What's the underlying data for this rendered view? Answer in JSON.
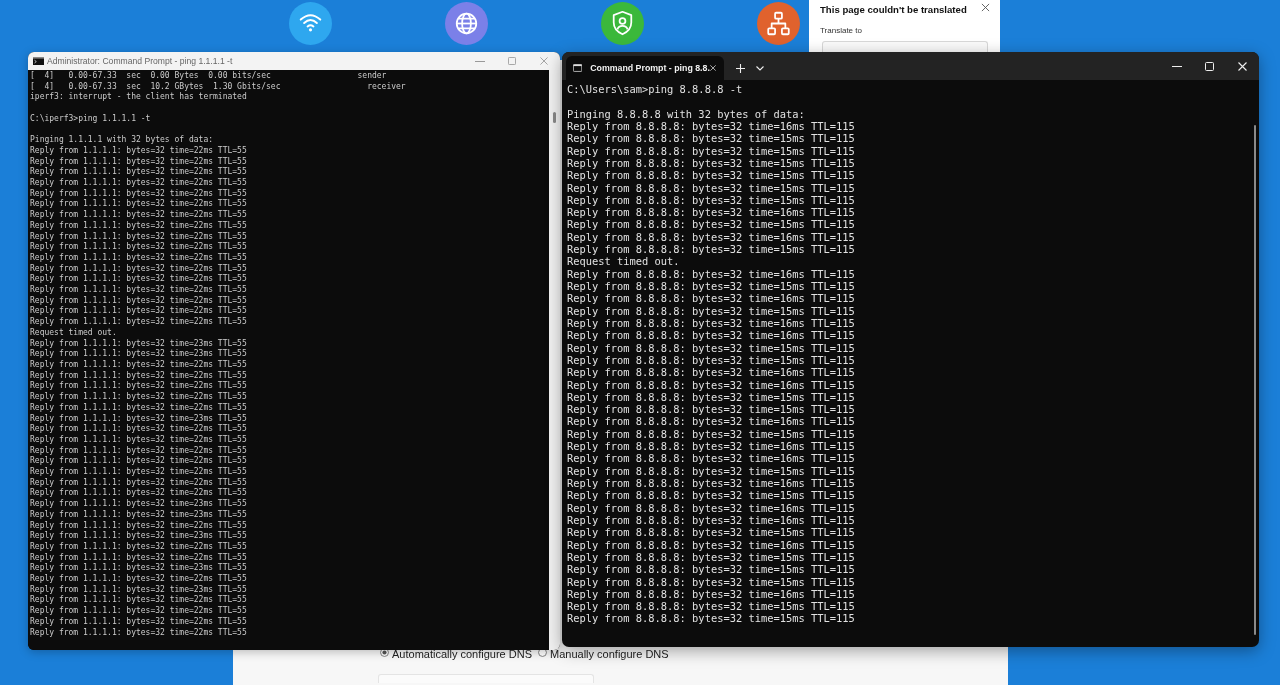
{
  "translate_popup": {
    "title": "This page couldn't be translated",
    "label": "Translate to"
  },
  "left_window": {
    "title": "Administrator: Command Prompt - ping 1.1.1.1 -t",
    "blocks": [
      [
        "[  4]   0.00-67.33  sec  0.00 Bytes  0.00 bits/sec                  sender",
        "[  4]   0.00-67.33  sec  10.2 GBytes  1.30 Gbits/sec                  receiver",
        "iperf3: interrupt - the client has terminated"
      ],
      [
        "C:\\iperf3>ping 1.1.1.1 -t"
      ],
      [
        "Pinging 1.1.1.1 with 32 bytes of data:",
        "Reply from 1.1.1.1: bytes=32 time=22ms TTL=55",
        "Reply from 1.1.1.1: bytes=32 time=22ms TTL=55",
        "Reply from 1.1.1.1: bytes=32 time=22ms TTL=55",
        "Reply from 1.1.1.1: bytes=32 time=22ms TTL=55",
        "Reply from 1.1.1.1: bytes=32 time=22ms TTL=55",
        "Reply from 1.1.1.1: bytes=32 time=22ms TTL=55",
        "Reply from 1.1.1.1: bytes=32 time=22ms TTL=55",
        "Reply from 1.1.1.1: bytes=32 time=22ms TTL=55",
        "Reply from 1.1.1.1: bytes=32 time=22ms TTL=55",
        "Reply from 1.1.1.1: bytes=32 time=22ms TTL=55",
        "Reply from 1.1.1.1: bytes=32 time=22ms TTL=55",
        "Reply from 1.1.1.1: bytes=32 time=22ms TTL=55",
        "Reply from 1.1.1.1: bytes=32 time=22ms TTL=55",
        "Reply from 1.1.1.1: bytes=32 time=22ms TTL=55",
        "Reply from 1.1.1.1: bytes=32 time=22ms TTL=55",
        "Reply from 1.1.1.1: bytes=32 time=22ms TTL=55",
        "Reply from 1.1.1.1: bytes=32 time=22ms TTL=55",
        "Request timed out.",
        "Reply from 1.1.1.1: bytes=32 time=23ms TTL=55",
        "Reply from 1.1.1.1: bytes=32 time=23ms TTL=55",
        "Reply from 1.1.1.1: bytes=32 time=22ms TTL=55",
        "Reply from 1.1.1.1: bytes=32 time=22ms TTL=55",
        "Reply from 1.1.1.1: bytes=32 time=22ms TTL=55",
        "Reply from 1.1.1.1: bytes=32 time=22ms TTL=55",
        "Reply from 1.1.1.1: bytes=32 time=22ms TTL=55",
        "Reply from 1.1.1.1: bytes=32 time=23ms TTL=55",
        "Reply from 1.1.1.1: bytes=32 time=22ms TTL=55",
        "Reply from 1.1.1.1: bytes=32 time=22ms TTL=55",
        "Reply from 1.1.1.1: bytes=32 time=22ms TTL=55",
        "Reply from 1.1.1.1: bytes=32 time=22ms TTL=55",
        "Reply from 1.1.1.1: bytes=32 time=22ms TTL=55",
        "Reply from 1.1.1.1: bytes=32 time=22ms TTL=55",
        "Reply from 1.1.1.1: bytes=32 time=22ms TTL=55",
        "Reply from 1.1.1.1: bytes=32 time=23ms TTL=55",
        "Reply from 1.1.1.1: bytes=32 time=23ms TTL=55",
        "Reply from 1.1.1.1: bytes=32 time=22ms TTL=55",
        "Reply from 1.1.1.1: bytes=32 time=23ms TTL=55",
        "Reply from 1.1.1.1: bytes=32 time=22ms TTL=55",
        "Reply from 1.1.1.1: bytes=32 time=22ms TTL=55",
        "Reply from 1.1.1.1: bytes=32 time=23ms TTL=55",
        "Reply from 1.1.1.1: bytes=32 time=22ms TTL=55",
        "Reply from 1.1.1.1: bytes=32 time=23ms TTL=55",
        "Reply from 1.1.1.1: bytes=32 time=22ms TTL=55",
        "Reply from 1.1.1.1: bytes=32 time=22ms TTL=55",
        "Reply from 1.1.1.1: bytes=32 time=22ms TTL=55",
        "Reply from 1.1.1.1: bytes=32 time=22ms TTL=55"
      ]
    ]
  },
  "right_window": {
    "tab_title": "Command Prompt - ping 8.8.",
    "blocks": [
      [
        "C:\\Users\\sam>ping 8.8.8.8 -t"
      ],
      [
        "Pinging 8.8.8.8 with 32 bytes of data:",
        "Reply from 8.8.8.8: bytes=32 time=16ms TTL=115",
        "Reply from 8.8.8.8: bytes=32 time=15ms TTL=115",
        "Reply from 8.8.8.8: bytes=32 time=15ms TTL=115",
        "Reply from 8.8.8.8: bytes=32 time=15ms TTL=115",
        "Reply from 8.8.8.8: bytes=32 time=15ms TTL=115",
        "Reply from 8.8.8.8: bytes=32 time=15ms TTL=115",
        "Reply from 8.8.8.8: bytes=32 time=15ms TTL=115",
        "Reply from 8.8.8.8: bytes=32 time=16ms TTL=115",
        "Reply from 8.8.8.8: bytes=32 time=15ms TTL=115",
        "Reply from 8.8.8.8: bytes=32 time=16ms TTL=115",
        "Reply from 8.8.8.8: bytes=32 time=15ms TTL=115",
        "Request timed out.",
        "Reply from 8.8.8.8: bytes=32 time=16ms TTL=115",
        "Reply from 8.8.8.8: bytes=32 time=15ms TTL=115",
        "Reply from 8.8.8.8: bytes=32 time=16ms TTL=115",
        "Reply from 8.8.8.8: bytes=32 time=15ms TTL=115",
        "Reply from 8.8.8.8: bytes=32 time=16ms TTL=115",
        "Reply from 8.8.8.8: bytes=32 time=16ms TTL=115",
        "Reply from 8.8.8.8: bytes=32 time=15ms TTL=115",
        "Reply from 8.8.8.8: bytes=32 time=15ms TTL=115",
        "Reply from 8.8.8.8: bytes=32 time=16ms TTL=115",
        "Reply from 8.8.8.8: bytes=32 time=16ms TTL=115",
        "Reply from 8.8.8.8: bytes=32 time=15ms TTL=115",
        "Reply from 8.8.8.8: bytes=32 time=15ms TTL=115",
        "Reply from 8.8.8.8: bytes=32 time=16ms TTL=115",
        "Reply from 8.8.8.8: bytes=32 time=15ms TTL=115",
        "Reply from 8.8.8.8: bytes=32 time=16ms TTL=115",
        "Reply from 8.8.8.8: bytes=32 time=16ms TTL=115",
        "Reply from 8.8.8.8: bytes=32 time=15ms TTL=115",
        "Reply from 8.8.8.8: bytes=32 time=16ms TTL=115",
        "Reply from 8.8.8.8: bytes=32 time=15ms TTL=115",
        "Reply from 8.8.8.8: bytes=32 time=16ms TTL=115",
        "Reply from 8.8.8.8: bytes=32 time=16ms TTL=115",
        "Reply from 8.8.8.8: bytes=32 time=15ms TTL=115",
        "Reply from 8.8.8.8: bytes=32 time=16ms TTL=115",
        "Reply from 8.8.8.8: bytes=32 time=15ms TTL=115",
        "Reply from 8.8.8.8: bytes=32 time=15ms TTL=115",
        "Reply from 8.8.8.8: bytes=32 time=15ms TTL=115",
        "Reply from 8.8.8.8: bytes=32 time=16ms TTL=115",
        "Reply from 8.8.8.8: bytes=32 time=15ms TTL=115",
        "Reply from 8.8.8.8: bytes=32 time=15ms TTL=115"
      ]
    ]
  },
  "dns_panel": {
    "options": [
      {
        "label": "Automatically configure DNS",
        "selected": true
      },
      {
        "label": "Manually configure DNS",
        "selected": false
      }
    ]
  }
}
